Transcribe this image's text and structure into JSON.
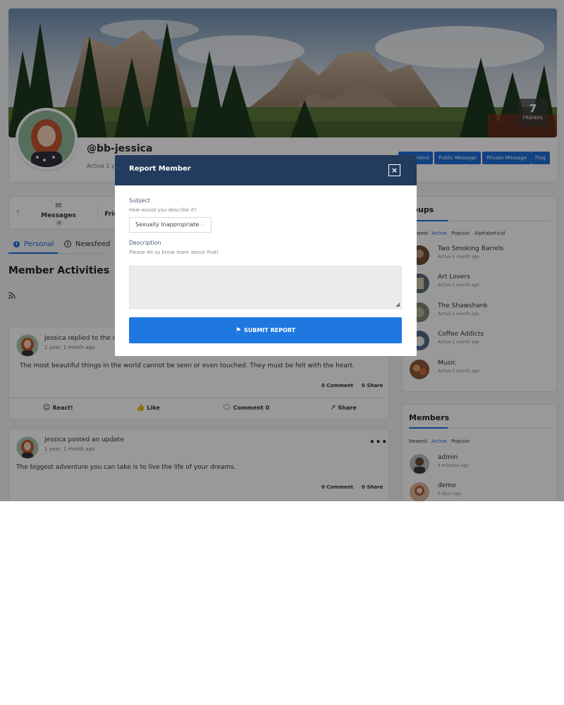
{
  "profile": {
    "friends_count": "7",
    "friends_label": "FRIENDS",
    "username": "@bb-jessica",
    "active_text": "Active 1 ye"
  },
  "actions": {
    "add_friend": "Add Friend",
    "public_message": "Public Message",
    "private_message": "Private Message",
    "flag": "Flag"
  },
  "nav": {
    "prev_arrow": "‹",
    "messages": {
      "label": "Messages",
      "count": "0"
    },
    "friends": {
      "label": "Frie"
    }
  },
  "subtabs": {
    "personal": "Personal",
    "newsfeed": "Newsfeed"
  },
  "main": {
    "section_title": "Member Activities"
  },
  "activities": [
    {
      "header": "Jessica replied to the d",
      "time": "1 year, 1 month ago",
      "body": "The most beautiful things in the world cannot be seen or even touched. They must be felt with the heart.",
      "comments": "0 Comment",
      "shares": "0 Share",
      "buttons": {
        "react": "React!",
        "like": "Like",
        "comment": "Comment 0",
        "share": "Share"
      }
    },
    {
      "header": "Jessica posted an update",
      "time": "1 year, 1 month ago",
      "body": "The biggest adventure you can take is to live the life of your dreams.",
      "comments": "0 Comment",
      "shares": "0 Share",
      "more": "•••"
    }
  ],
  "groups_widget": {
    "title": "roups",
    "filters": [
      "west",
      "Active",
      "Popular",
      "Alphabetical"
    ],
    "items": [
      {
        "name": "Two Smoking Barrels",
        "sub": "Active 1 month ago"
      },
      {
        "name": "Art Lovers",
        "sub": "Active 1 month ago"
      },
      {
        "name": "The Shawshank",
        "sub": "Active 1 month ago"
      },
      {
        "name": "Coffee Addicts",
        "sub": "Active 1 month ago"
      },
      {
        "name": "Music",
        "sub": "Active 1 month ago"
      }
    ]
  },
  "members_widget": {
    "title": "Members",
    "filters": [
      "Newest",
      "Active",
      "Popular"
    ],
    "items": [
      {
        "name": "admin",
        "sub": "4 minutes ago"
      },
      {
        "name": "demo",
        "sub": "6 days ago"
      }
    ]
  },
  "modal": {
    "title": "Report Member",
    "close": "×",
    "subject_label": "Subject",
    "subject_hint": "How would you describe it?",
    "subject_value": "Sexually Inappropriate",
    "description_label": "Description",
    "description_hint": "Please let us know more about that!",
    "textarea_value": "",
    "submit_label": "SUBMIT REPORT"
  },
  "colors": {
    "accent": "#1e6fd9",
    "modal_header": "#233b5c",
    "submit": "#1e78e0"
  }
}
